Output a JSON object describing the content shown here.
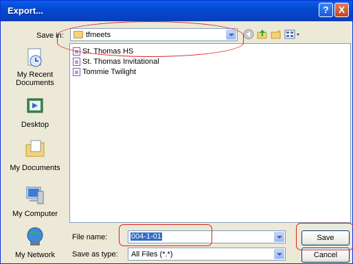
{
  "window": {
    "title": "Export..."
  },
  "save_in": {
    "label": "Save in:",
    "value": "tfmeets"
  },
  "places": [
    {
      "label": "My Recent Documents",
      "icon": "recent-documents-icon"
    },
    {
      "label": "Desktop",
      "icon": "desktop-icon"
    },
    {
      "label": "My Documents",
      "icon": "my-documents-icon"
    },
    {
      "label": "My Computer",
      "icon": "my-computer-icon"
    },
    {
      "label": "My Network",
      "icon": "my-network-icon"
    }
  ],
  "files": [
    {
      "name": "St. Thomas HS"
    },
    {
      "name": "St. Thomas Invitational"
    },
    {
      "name": "Tommie Twilight"
    }
  ],
  "file_name": {
    "label": "File name:",
    "value": "004-1-01"
  },
  "save_as_type": {
    "label": "Save as type:",
    "value": "All Files (*.*)"
  },
  "buttons": {
    "save": "Save",
    "cancel": "Cancel"
  },
  "title_buttons": {
    "help": "?",
    "close": "X"
  },
  "colors": {
    "titlebar": "#0449D0",
    "annotation": "#D9211E",
    "face": "#ECE9D8"
  }
}
